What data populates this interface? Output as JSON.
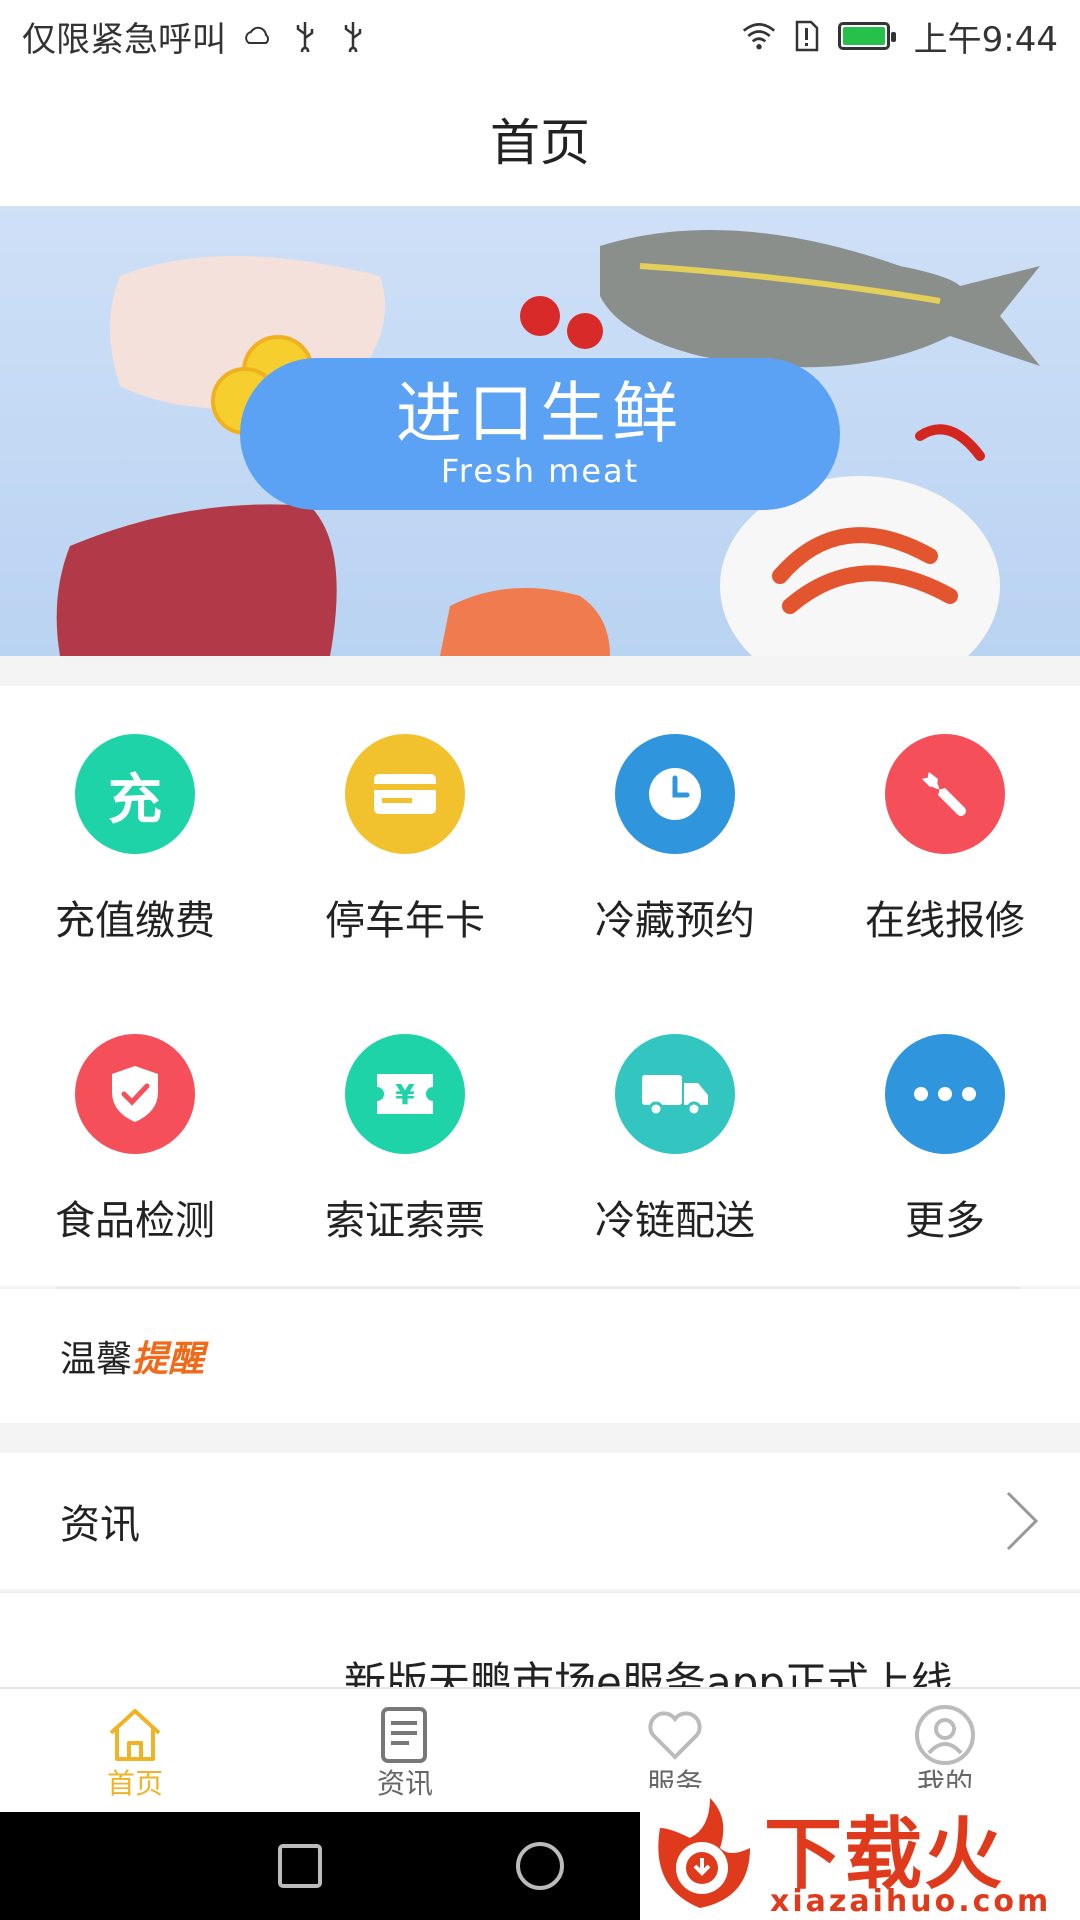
{
  "status_bar": {
    "carrier_text": "仅限紧急呼叫",
    "time": "上午9:44",
    "icons": [
      "weather-icon",
      "usb-icon",
      "usb-icon",
      "wifi-icon",
      "alert-sim-icon",
      "battery-icon"
    ]
  },
  "header": {
    "title": "首页"
  },
  "banner": {
    "title_cn": "进口生鲜",
    "title_en": "Fresh meat",
    "pill_color": "#5ba2f5"
  },
  "grid": {
    "items": [
      {
        "label": "充值缴费",
        "icon": "recharge-icon",
        "glyph": "充",
        "color": "#1fd3a8"
      },
      {
        "label": "停车年卡",
        "icon": "parking-card-icon",
        "color": "#f2c12e"
      },
      {
        "label": "冷藏预约",
        "icon": "clock-icon",
        "color": "#2f95dd"
      },
      {
        "label": "在线报修",
        "icon": "wrench-icon",
        "color": "#f5505a"
      },
      {
        "label": "食品检测",
        "icon": "shield-check-icon",
        "color": "#f5505a"
      },
      {
        "label": "索证索票",
        "icon": "ticket-icon",
        "glyph": "¥",
        "color": "#1fd3a8"
      },
      {
        "label": "冷链配送",
        "icon": "truck-icon",
        "color": "#33c6c0"
      },
      {
        "label": "更多",
        "icon": "more-icon",
        "color": "#2f95dd"
      }
    ]
  },
  "reminder": {
    "label_a": "温馨",
    "label_b": "提醒"
  },
  "news": {
    "header": "资讯",
    "items": [
      {
        "title": "新版天鹏市场e服务app正式上线"
      }
    ]
  },
  "tabbar": {
    "tabs": [
      {
        "label": "首页",
        "icon": "home-icon",
        "active": true
      },
      {
        "label": "资讯",
        "icon": "news-icon",
        "active": false
      },
      {
        "label": "服务",
        "icon": "heart-icon",
        "active": false
      },
      {
        "label": "我的",
        "icon": "user-icon",
        "active": false
      }
    ],
    "active_color": "#f0b325"
  },
  "watermark": {
    "main": "下载火",
    "sub": "xiazaihuo.com"
  }
}
